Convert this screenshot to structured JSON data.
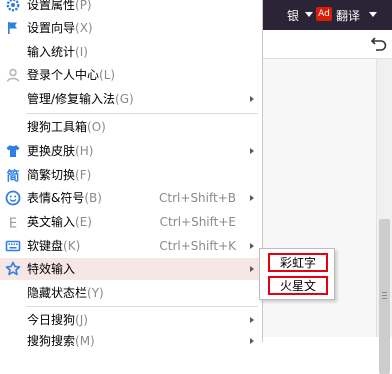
{
  "background_window": {
    "header_text_left": "银",
    "ad_badge": "Ad",
    "header_text_right": "翻译",
    "return_icon": "return-arrow-icon",
    "header_color": "#2a2436"
  },
  "menu": {
    "items": [
      {
        "label": "设置属性",
        "key": "(P)",
        "icon": "gear-icon"
      },
      {
        "label": "设置向导",
        "key": "(X)",
        "icon": "flag-icon"
      },
      {
        "label": "输入统计",
        "key": "(I)",
        "icon": ""
      },
      {
        "label": "登录个人中心",
        "key": "(L)",
        "icon": "user-icon"
      },
      {
        "label": "管理/修复输入法",
        "key": "(G)",
        "icon": ""
      },
      {
        "label": "搜狗工具箱",
        "key": "(O)",
        "icon": ""
      },
      {
        "label": "更换皮肤",
        "key": "(H)",
        "icon": "tshirt-icon"
      },
      {
        "label": "简繁切换",
        "key": "(F)",
        "icon": "simplified-traditional-icon"
      },
      {
        "label": "表情&符号",
        "key": "(B)",
        "icon": "smiley-icon",
        "shortcut": "Ctrl+Shift+B"
      },
      {
        "label": "英文输入",
        "key": "(E)",
        "icon": "english-e-icon",
        "shortcut": "Ctrl+Shift+E"
      },
      {
        "label": "软键盘",
        "key": "(K)",
        "icon": "keyboard-icon",
        "shortcut": "Ctrl+Shift+K"
      },
      {
        "label": "特效输入",
        "key": "",
        "icon": "special-effect-icon"
      },
      {
        "label": "隐藏状态栏",
        "key": "(Y)",
        "icon": ""
      },
      {
        "label": "今日搜狗",
        "key": "(J)",
        "icon": ""
      },
      {
        "label": "搜狗搜索",
        "key": "(M)",
        "icon": ""
      }
    ]
  },
  "submenu": {
    "items": [
      "彩虹字",
      "火星文"
    ],
    "highlight_color": "#e60012"
  },
  "colors": {
    "accent_blue": "#2f7fe0",
    "highlight_bg": "#f6e6e6"
  }
}
